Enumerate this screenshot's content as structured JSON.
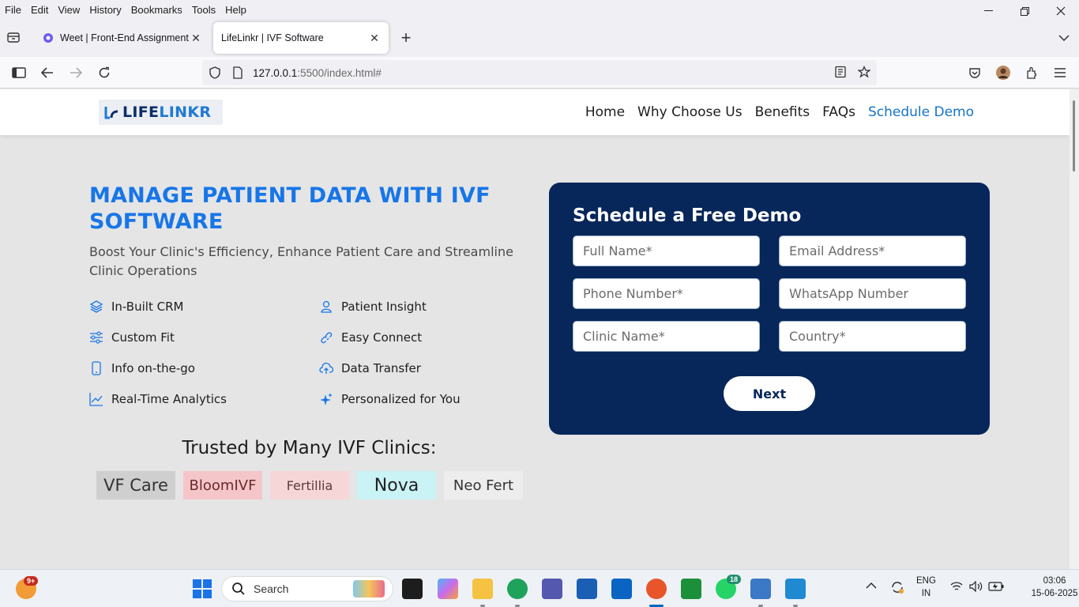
{
  "browser": {
    "menu": [
      "File",
      "Edit",
      "View",
      "History",
      "Bookmarks",
      "Tools",
      "Help"
    ],
    "tabs": [
      {
        "title": "Weet | Front-End Assignment -",
        "close": "✕"
      },
      {
        "title": "LifeLinkr | IVF Software",
        "close": "✕"
      }
    ],
    "new_tab": "+",
    "url_host": "127.0.0.1",
    "url_rest": ":5500/index.html#"
  },
  "site": {
    "logo_a": "LIFE",
    "logo_b": "LINKR",
    "nav": [
      "Home",
      "Why Choose Us",
      "Benefits",
      "FAQs",
      "Schedule Demo"
    ],
    "hero_title": "MANAGE PATIENT DATA WITH IVF SOFTWARE",
    "hero_sub": "Boost Your Clinic's Efficiency, Enhance Patient Care and Streamline Clinic Operations",
    "features": [
      {
        "label": "In-Built CRM",
        "icon": "layers-icon"
      },
      {
        "label": "Patient Insight",
        "icon": "user-icon"
      },
      {
        "label": "Custom Fit",
        "icon": "sliders-icon"
      },
      {
        "label": "Easy Connect",
        "icon": "link-icon"
      },
      {
        "label": "Info on-the-go",
        "icon": "mobile-icon"
      },
      {
        "label": "Data Transfer",
        "icon": "cloud-upload-icon"
      },
      {
        "label": "Real-Time Analytics",
        "icon": "chart-line-icon"
      },
      {
        "label": "Personalized for You",
        "icon": "sparkle-icon"
      }
    ],
    "trusted_title": "Trusted by Many IVF Clinics:",
    "clinics": [
      {
        "name": "VF Care",
        "bg": "#cfcfcf"
      },
      {
        "name": "BloomIVF",
        "bg": "#f5c6c9"
      },
      {
        "name": "Fertillia",
        "bg": "#f7d6d8"
      },
      {
        "name": "Nova",
        "bg": "#c9f3f5"
      },
      {
        "name": "Neo Fert",
        "bg": "#ededed"
      }
    ],
    "form": {
      "title": "Schedule a Free Demo",
      "full_name": "Full Name*",
      "email": "Email Address*",
      "phone": "Phone Number*",
      "whatsapp": "WhatsApp Number",
      "clinic": "Clinic Name*",
      "country": "Country*",
      "next": "Next"
    },
    "colors": {
      "accent": "#1776e8",
      "card": "#072659"
    }
  },
  "taskbar": {
    "search": "Search",
    "widget_badge": "9+",
    "whatsapp_badge": "18",
    "lang_top": "ENG",
    "lang_bottom": "IN",
    "time": "03:06",
    "date": "15-06-2025"
  }
}
